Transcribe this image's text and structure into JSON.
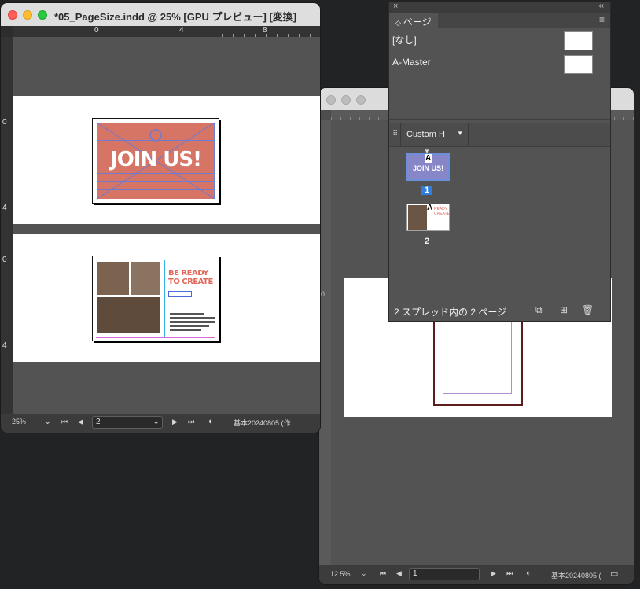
{
  "front_window": {
    "title": "*05_PageSize.indd @ 25% [GPU プレビュー] [変換]",
    "ruler_top": [
      "0",
      "4",
      "8"
    ],
    "ruler_left": [
      "0",
      "4",
      "0",
      "4"
    ],
    "page1": {
      "headline": "JOIN US!"
    },
    "page2": {
      "headline": [
        "BE READY",
        "TO CREATE"
      ]
    },
    "status": {
      "zoom": "25%",
      "page": "2",
      "profile": "基本20240805 (作"
    }
  },
  "back_window": {
    "ruler_left": "0",
    "status": {
      "zoom": "12.5%",
      "page": "1",
      "profile": "基本20240805 ("
    }
  },
  "pages_panel": {
    "close_glyph": "×",
    "collapse_glyph": "‹‹",
    "tab_label": "ページ",
    "tab_icon": "◇",
    "menu_icon": "≡",
    "masters": [
      {
        "label": "[なし]"
      },
      {
        "label": "A-Master"
      }
    ],
    "page_size": "Custom H",
    "pages": [
      {
        "number": "1",
        "master_prefix": "A",
        "headline": "JOIN US!"
      },
      {
        "number": "2",
        "master_prefix": "A",
        "headline": "READY CREATE"
      }
    ],
    "footer_text": "2 スプレッド内の 2 ページ"
  }
}
